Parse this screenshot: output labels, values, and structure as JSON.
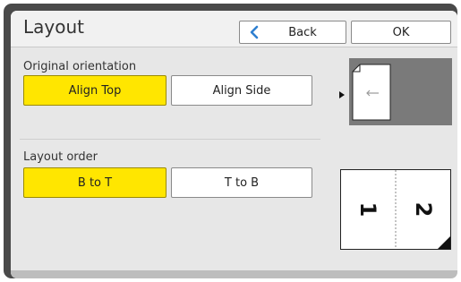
{
  "header": {
    "title": "Layout",
    "back_label": "Back",
    "ok_label": "OK"
  },
  "orientation": {
    "label": "Original orientation",
    "options": [
      "Align Top",
      "Align Side"
    ],
    "selected": "Align Top"
  },
  "layout_order": {
    "label": "Layout order",
    "options": [
      "B to T",
      "T to B"
    ],
    "selected": "B to T"
  },
  "preview": {
    "page_numbers": [
      "1",
      "2"
    ]
  },
  "colors": {
    "selected": "#ffe600",
    "accent_icon": "#2f7fd0",
    "frame": "#4a4a4a"
  },
  "icons": {
    "back": "chevron-left-icon",
    "pointer": "triangle-right-icon"
  }
}
